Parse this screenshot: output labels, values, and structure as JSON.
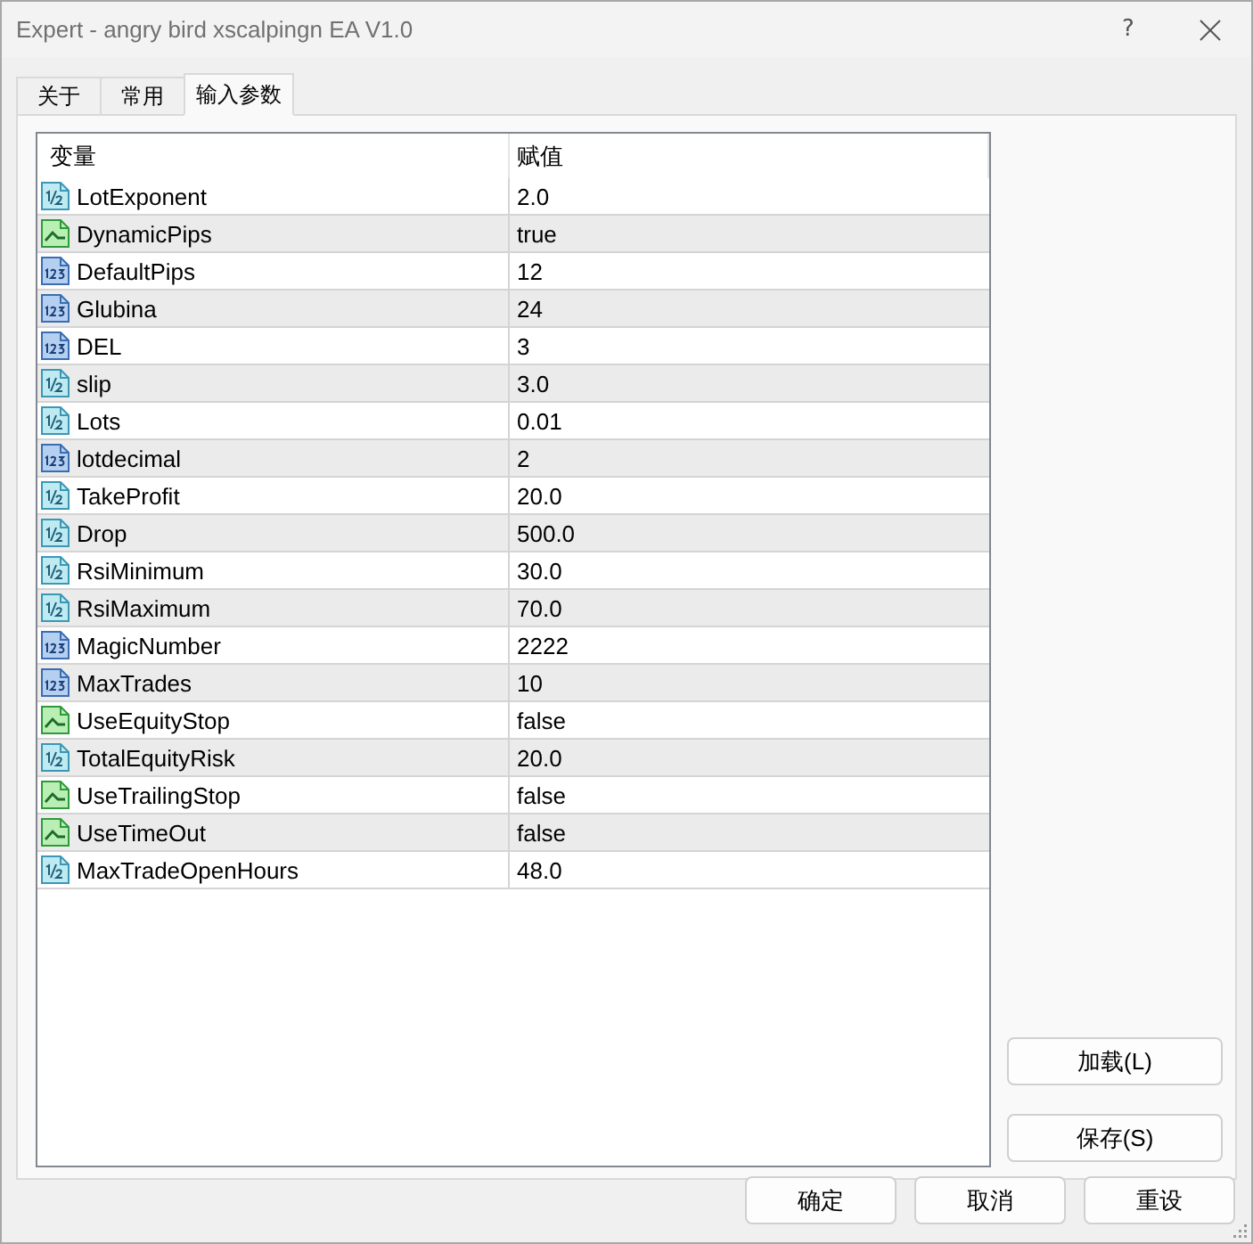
{
  "window": {
    "title": "Expert - angry bird xscalpingn EA V1.0",
    "help_button": "?"
  },
  "tabs": [
    {
      "label": "关于",
      "selected": false
    },
    {
      "label": "常用",
      "selected": false
    },
    {
      "label": "输入参数",
      "selected": true
    }
  ],
  "table": {
    "columns": [
      "变量",
      "赋值"
    ],
    "rows": [
      {
        "kind": "double",
        "name": "LotExponent",
        "value": "2.0"
      },
      {
        "kind": "bool",
        "name": "DynamicPips",
        "value": "true"
      },
      {
        "kind": "int",
        "name": "DefaultPips",
        "value": "12"
      },
      {
        "kind": "int",
        "name": "Glubina",
        "value": "24"
      },
      {
        "kind": "int",
        "name": "DEL",
        "value": "3"
      },
      {
        "kind": "double",
        "name": "slip",
        "value": "3.0"
      },
      {
        "kind": "double",
        "name": "Lots",
        "value": "0.01"
      },
      {
        "kind": "int",
        "name": "lotdecimal",
        "value": "2"
      },
      {
        "kind": "double",
        "name": "TakeProfit",
        "value": "20.0"
      },
      {
        "kind": "double",
        "name": "Drop",
        "value": "500.0"
      },
      {
        "kind": "double",
        "name": "RsiMinimum",
        "value": "30.0"
      },
      {
        "kind": "double",
        "name": "RsiMaximum",
        "value": "70.0"
      },
      {
        "kind": "int",
        "name": "MagicNumber",
        "value": "2222"
      },
      {
        "kind": "int",
        "name": "MaxTrades",
        "value": "10"
      },
      {
        "kind": "bool",
        "name": "UseEquityStop",
        "value": "false"
      },
      {
        "kind": "double",
        "name": "TotalEquityRisk",
        "value": "20.0"
      },
      {
        "kind": "bool",
        "name": "UseTrailingStop",
        "value": "false"
      },
      {
        "kind": "bool",
        "name": "UseTimeOut",
        "value": "false"
      },
      {
        "kind": "double",
        "name": "MaxTradeOpenHours",
        "value": "48.0"
      }
    ]
  },
  "side_buttons": [
    "加载(L)",
    "保存(S)"
  ],
  "buttons": [
    "确定",
    "取消",
    "重设"
  ]
}
